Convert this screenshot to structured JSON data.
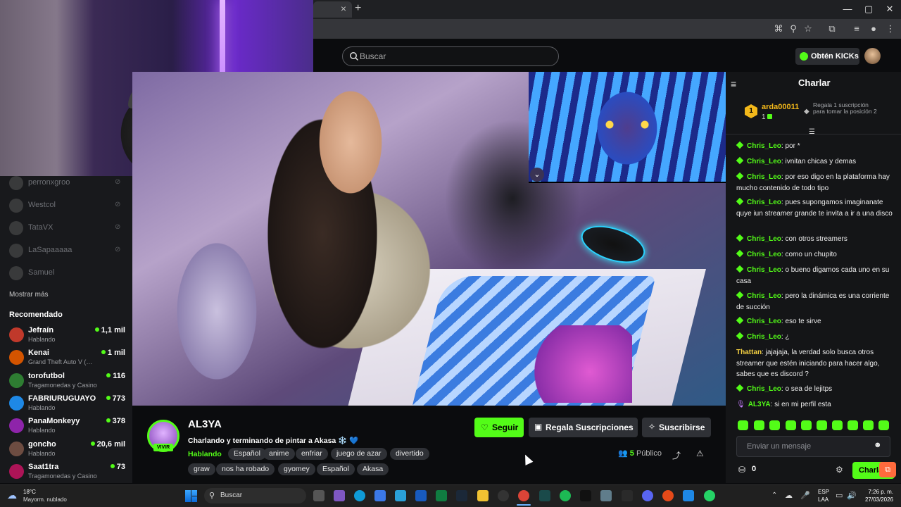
{
  "browser": {
    "tab_close": "×",
    "new_tab": "+",
    "min": "—",
    "max": "▢",
    "close": "✕"
  },
  "header": {
    "search_placeholder": "Buscar",
    "kicks_label": "Obtén KICKs"
  },
  "sidebar": {
    "following": [
      {
        "name": "perronxgroo"
      },
      {
        "name": "Westcol"
      },
      {
        "name": "TataVX"
      },
      {
        "name": "LaSapaaaaa"
      },
      {
        "name": "Samuel"
      }
    ],
    "show_more": "Mostrar más",
    "recommended_title": "Recomendado",
    "recommended": [
      {
        "name": "Jefraín",
        "category": "Hablando",
        "viewers": "1,1 mil",
        "color": "#c0392b"
      },
      {
        "name": "Kenai",
        "category": "Grand Theft Auto V (…",
        "viewers": "1 mil",
        "color": "#d35400"
      },
      {
        "name": "torofutbol",
        "category": "Tragamonedas y Casino",
        "viewers": "116",
        "color": "#2e7d32"
      },
      {
        "name": "FABRIURUGUAYO",
        "category": "Hablando",
        "viewers": "773",
        "color": "#1e88e5"
      },
      {
        "name": "PanaMonkeyy",
        "category": "Hablando",
        "viewers": "378",
        "color": "#8e24aa"
      },
      {
        "name": "goncho",
        "category": "Hablando",
        "viewers": "20,6 mil",
        "color": "#6d4c41"
      },
      {
        "name": "Saat1tra",
        "category": "Tragamonedas y Casino",
        "viewers": "73",
        "color": "#ad1457"
      }
    ]
  },
  "stream": {
    "live_badge": "VIVIR",
    "streamer": "AL3YA",
    "title": "Charlando y terminando de pintar a Akasa ❄️ 💙",
    "category": "Hablando",
    "tags_row1": [
      "Español",
      "anime",
      "enfriar",
      "juego de azar",
      "divertido"
    ],
    "tags_row2": [
      "graw",
      "nos ha robado",
      "gyomey",
      "Español",
      "Akasa"
    ],
    "follow_label": "Seguir",
    "gift_label": "Regala Suscripciones",
    "subscribe_label": "Suscribirse",
    "viewer_count": "5",
    "viewer_label": "Público"
  },
  "chat": {
    "title": "Charlar",
    "pinned": {
      "rank": "1",
      "user": "arda00011",
      "count": "1",
      "gift_text": "Regala 1 suscripción para tomar la posición 2"
    },
    "messages": [
      {
        "user": "Chris_Leo",
        "text": "por *"
      },
      {
        "user": "Chris_Leo",
        "text": "ivnitan chicas y demas"
      },
      {
        "user": "Chris_Leo",
        "text": "por eso digo en la plataforma hay mucho contenido de todo tipo"
      },
      {
        "user": "Chris_Leo",
        "text": "pues supongamos imaginanate quye iun streamer grande te invita a ir a una disco"
      },
      {
        "user": "Chris_Leo",
        "text": "con otros streamers"
      },
      {
        "user": "Chris_Leo",
        "text": "como un chupito"
      },
      {
        "user": "Chris_Leo",
        "text": "o bueno digamos cada uno en su casa"
      },
      {
        "user": "Chris_Leo",
        "text": "pero la dinámica es una corriente de succión"
      },
      {
        "user": "Chris_Leo",
        "text": "eso te sirve"
      },
      {
        "user": "Chris_Leo",
        "text": "¿"
      },
      {
        "user": "Thattan",
        "text": "jajajaja, la verdad solo busca otros streamer que estén iniciando para hacer algo, sabes que es discord ?"
      },
      {
        "user": "Chris_Leo",
        "text": "o sea de lejitps"
      },
      {
        "user": "AL3YA",
        "text": "si en mi perfil esta"
      }
    ],
    "input_placeholder": "Enviar un mensaje",
    "points": "0",
    "send_label": "Charlar"
  },
  "taskbar": {
    "temp": "18°C",
    "weather": "Mayorm. nublado",
    "search_label": "Buscar",
    "lang1": "ESP",
    "lang2": "LAA",
    "time": "7:26 p. m.",
    "date": "27/03/2026"
  },
  "colors": {
    "accent": "#53fc18",
    "background": "#0b0c0e",
    "chat": "#141517"
  }
}
